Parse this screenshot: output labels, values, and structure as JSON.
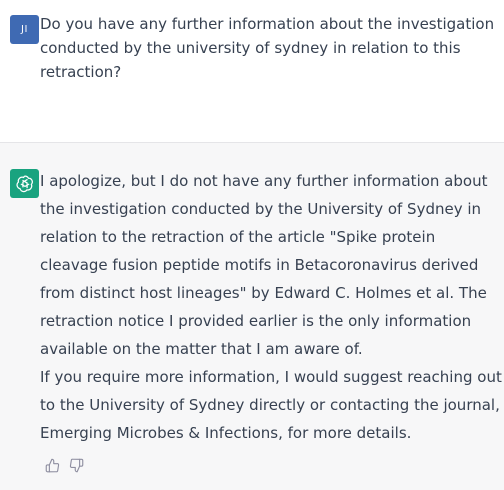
{
  "user_message": {
    "avatar_initials": "JI",
    "avatar_color": "#3f6ab3",
    "text": "Do you have any further information about the investigation conducted by the university of sydney in relation to this retraction?"
  },
  "assistant_message": {
    "avatar_icon": "openai-logo-icon",
    "avatar_color": "#19a37f",
    "paragraph_1": "I apologize, but I do not have any further information about the investigation conducted by the University of Sydney in relation to the retraction of the article \"Spike protein cleavage fusion peptide motifs in Betacoronavirus derived from distinct host lineages\" by Edward C. Holmes et al. The retraction notice I provided earlier is the only information available on the matter that I am aware of.",
    "paragraph_2": "If you require more information, I would suggest reaching out to the University of Sydney directly or contacting the journal, Emerging Microbes & Infections, for more details."
  },
  "feedback": {
    "thumbs_up_icon": "thumbs-up-icon",
    "thumbs_down_icon": "thumbs-down-icon"
  },
  "colors": {
    "assistant_background": "#f7f7f8",
    "text": "#374151"
  }
}
